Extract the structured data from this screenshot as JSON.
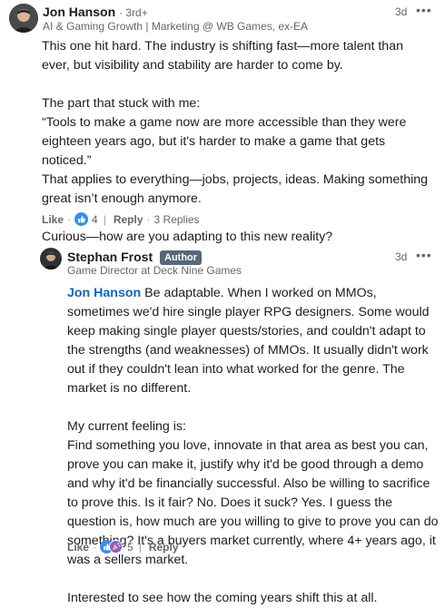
{
  "comment": {
    "author": "Jon Hanson",
    "degree": "· 3rd+",
    "headline": "AI & Gaming Growth | Marketing @ WB Games, ex-EA",
    "time": "3d",
    "more_icon": "ellipsis-icon",
    "body": {
      "p1": "This one hit hard. The industry is shifting fast—more talent than ever, but visibility and stability are harder to come by.",
      "p2a": "The part that stuck with me:",
      "p2b": "“Tools to make a game now are more accessible than they were eighteen years ago, but it's harder to make a game that gets noticed.”",
      "p2c": "That applies to everything—jobs, projects, ideas. Making something great isn’t enough anymore.",
      "p3": "Curious—how are you adapting to this new reality?"
    },
    "actions": {
      "like": "Like",
      "like_count": "4",
      "reply": "Reply",
      "replies": "3 Replies"
    }
  },
  "reply": {
    "author": "Stephan Frost",
    "badge": "Author",
    "headline": "Game Director at Deck Nine Games",
    "time": "3d",
    "more_icon": "ellipsis-icon",
    "body": {
      "mention": "Jon Hanson",
      "p1": " Be adaptable. When I worked on MMOs, sometimes we'd hire single player RPG designers. Some would keep making single player quests/stories, and couldn't adapt to the strengths (and weaknesses) of MMOs. It usually didn't work out if they couldn't lean into what worked for the genre. The market is no different.",
      "p2a": "My current feeling is:",
      "p2b": "Find something you love, innovate in that area as best you can, prove you can make it, justify why it'd be good through a demo and why it'd be financially successful. Also be willing to sacrifice to prove this. Is it fair? No. Does it suck? Yes. I guess the question is, how much are you willing to give to prove you can do something? It's a buyers market currently, where 4+ years ago, it was a sellers market.",
      "p3": "Interested to see how the coming years shift this at all."
    },
    "actions": {
      "like": "Like",
      "like_count": "5",
      "reply": "Reply"
    }
  },
  "colors": {
    "link": "#0a66c2",
    "like_blue": "#378fe9",
    "celebrate_purple": "#8f5bd6",
    "badge": "#56687a"
  }
}
